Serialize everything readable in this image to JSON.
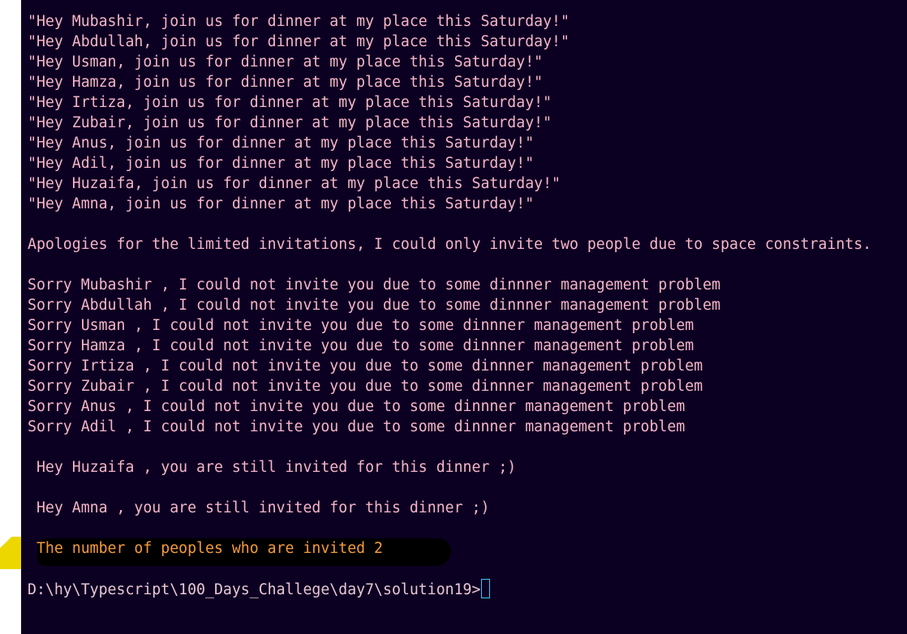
{
  "invitations": [
    "\"Hey Mubashir, join us for dinner at my place this Saturday!\"",
    "\"Hey Abdullah, join us for dinner at my place this Saturday!\"",
    "\"Hey Usman, join us for dinner at my place this Saturday!\"",
    "\"Hey Hamza, join us for dinner at my place this Saturday!\"",
    "\"Hey Irtiza, join us for dinner at my place this Saturday!\"",
    "\"Hey Zubair, join us for dinner at my place this Saturday!\"",
    "\"Hey Anus, join us for dinner at my place this Saturday!\"",
    "\"Hey Adil, join us for dinner at my place this Saturday!\"",
    "\"Hey Huzaifa, join us for dinner at my place this Saturday!\"",
    "\"Hey Amna, join us for dinner at my place this Saturday!\""
  ],
  "apology": "Apologies for the limited invitations, I could only invite two people due to space constraints.",
  "sorry_messages": [
    "Sorry Mubashir , I could not invite you due to some dinnner management problem",
    "Sorry Abdullah , I could not invite you due to some dinnner management problem",
    "Sorry Usman , I could not invite you due to some dinnner management problem",
    "Sorry Hamza , I could not invite you due to some dinnner management problem",
    "Sorry Irtiza , I could not invite you due to some dinnner management problem",
    "Sorry Zubair , I could not invite you due to some dinnner management problem",
    "Sorry Anus , I could not invite you due to some dinnner management problem",
    "Sorry Adil , I could not invite you due to some dinnner management problem"
  ],
  "still_invited": [
    " Hey Huzaifa , you are still invited for this dinner ;)",
    " Hey Amna , you are still invited for this dinner ;)"
  ],
  "summary": " The number of peoples who are invited 2",
  "prompt": "D:\\hy\\Typescript\\100_Days_Challege\\day7\\solution19>",
  "colors": {
    "background": "#0c0022",
    "text": "#f6b5c8",
    "summary_text": "#f49a3a",
    "cursor": "#36c7ff",
    "marker": "#ecd800"
  }
}
